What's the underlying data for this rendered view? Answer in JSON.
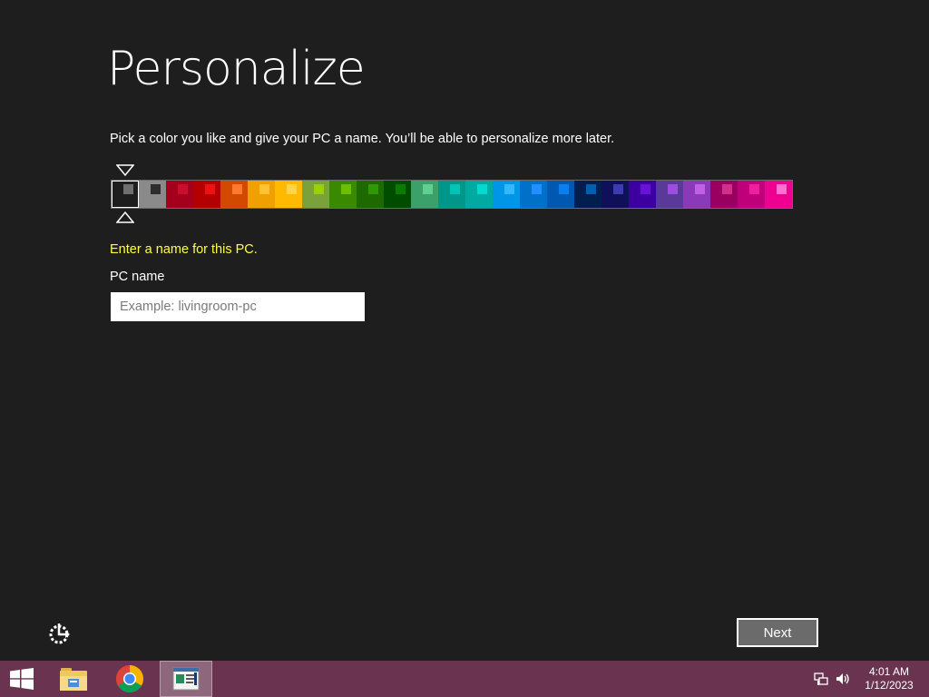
{
  "page": {
    "title": "Personalize",
    "description": "Pick a color you like and give your PC a name. You’ll be able to personalize more later.",
    "name_prompt": "Enter a name for this PC.",
    "pc_name_label": "PC name",
    "pc_name_value": "",
    "pc_name_placeholder": "Example: livingroom-pc",
    "next_label": "Next",
    "selected_color_index": 0
  },
  "palette": [
    {
      "bg": "#1e1e1e",
      "chip": "#707070"
    },
    {
      "bg": "#8a8a8a",
      "chip": "#2d2d2d"
    },
    {
      "bg": "#a4001e",
      "chip": "#c8102e"
    },
    {
      "bg": "#b40000",
      "chip": "#ee1111"
    },
    {
      "bg": "#d24a00",
      "chip": "#ff7a30"
    },
    {
      "bg": "#f0a000",
      "chip": "#ffc233"
    },
    {
      "bg": "#ffb900",
      "chip": "#ffd44a"
    },
    {
      "bg": "#7aa23a",
      "chip": "#9bd100"
    },
    {
      "bg": "#3a8a00",
      "chip": "#6cbf00"
    },
    {
      "bg": "#1e6a00",
      "chip": "#2c9a00"
    },
    {
      "bg": "#004d00",
      "chip": "#0a7d00"
    },
    {
      "bg": "#3ca06a",
      "chip": "#60cf8f"
    },
    {
      "bg": "#00968a",
      "chip": "#00c4b5"
    },
    {
      "bg": "#00aaa0",
      "chip": "#00dbd0"
    },
    {
      "bg": "#0096e8",
      "chip": "#33b8ff"
    },
    {
      "bg": "#0070c8",
      "chip": "#1e90ff"
    },
    {
      "bg": "#0058b0",
      "chip": "#0a80f0"
    },
    {
      "bg": "#001e50",
      "chip": "#0060b0"
    },
    {
      "bg": "#10105a",
      "chip": "#3c3cb0"
    },
    {
      "bg": "#3c00a0",
      "chip": "#6a10d8"
    },
    {
      "bg": "#5a3a98",
      "chip": "#9b4ee0"
    },
    {
      "bg": "#8a3ab8",
      "chip": "#c060e8"
    },
    {
      "bg": "#9a0060",
      "chip": "#d0308a"
    },
    {
      "bg": "#c0007a",
      "chip": "#ee20a0"
    },
    {
      "bg": "#ee0090",
      "chip": "#ff70d0"
    }
  ],
  "taskbar": {
    "time": "4:01 AM",
    "date": "1/12/2023",
    "apps": [
      "windows-start",
      "file-explorer",
      "chrome",
      "windows-setup"
    ]
  },
  "colors": {
    "background": "#1f1e1f",
    "taskbar": "#6a3450",
    "prompt": "#ffff40",
    "button_bg": "#6b6b6b"
  }
}
